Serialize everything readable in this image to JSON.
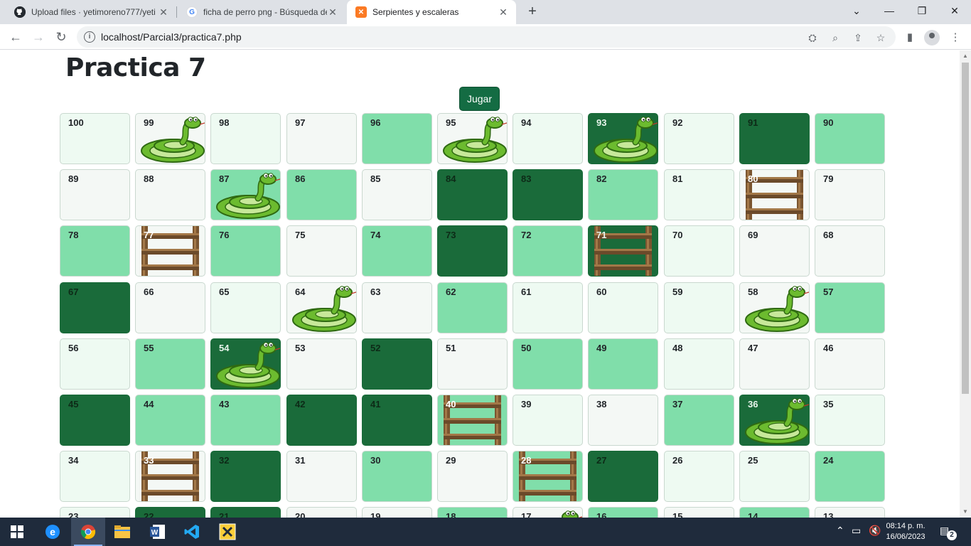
{
  "browser": {
    "tabs": [
      {
        "title": "Upload files · yetimoreno777/yeti",
        "icon": "github-icon",
        "active": false
      },
      {
        "title": "ficha de perro png - Búsqueda de",
        "icon": "google-icon",
        "active": false
      },
      {
        "title": "Serpientes y escaleras",
        "icon": "xampp-icon",
        "active": true
      }
    ],
    "new_tab_label": "+",
    "url": "localhost/Parcial3/practica7.php"
  },
  "page": {
    "title": "Practica 7",
    "play_button": "Jugar"
  },
  "board": {
    "colors": {
      "light": "#eefaf2",
      "white": "#f4f8f5",
      "mid": "#80deaa",
      "dark": "#1a6b3a"
    },
    "rows": [
      [
        {
          "n": "100",
          "color": "light"
        },
        {
          "n": "99",
          "color": "white",
          "piece": "snake"
        },
        {
          "n": "98",
          "color": "light"
        },
        {
          "n": "97",
          "color": "white"
        },
        {
          "n": "96",
          "color": "mid"
        },
        {
          "n": "95",
          "color": "white",
          "piece": "snake"
        },
        {
          "n": "94",
          "color": "light"
        },
        {
          "n": "93",
          "color": "dark",
          "piece": "snake"
        },
        {
          "n": "92",
          "color": "light"
        },
        {
          "n": "91",
          "color": "dark"
        },
        {
          "n": "90",
          "color": "mid"
        }
      ],
      [
        {
          "n": "89",
          "color": "white"
        },
        {
          "n": "88",
          "color": "white"
        },
        {
          "n": "87",
          "color": "mid",
          "piece": "snake"
        },
        {
          "n": "86",
          "color": "mid"
        },
        {
          "n": "85",
          "color": "white"
        },
        {
          "n": "84",
          "color": "dark"
        },
        {
          "n": "83",
          "color": "dark"
        },
        {
          "n": "82",
          "color": "mid"
        },
        {
          "n": "81",
          "color": "light"
        },
        {
          "n": "80",
          "color": "white",
          "piece": "ladder"
        },
        {
          "n": "79",
          "color": "white"
        }
      ],
      [
        {
          "n": "78",
          "color": "mid"
        },
        {
          "n": "77",
          "color": "white",
          "piece": "ladder"
        },
        {
          "n": "76",
          "color": "mid"
        },
        {
          "n": "75",
          "color": "white"
        },
        {
          "n": "74",
          "color": "mid"
        },
        {
          "n": "73",
          "color": "dark"
        },
        {
          "n": "72",
          "color": "mid"
        },
        {
          "n": "71",
          "color": "dark",
          "piece": "ladder"
        },
        {
          "n": "70",
          "color": "light"
        },
        {
          "n": "69",
          "color": "white"
        },
        {
          "n": "68",
          "color": "white"
        }
      ],
      [
        {
          "n": "67",
          "color": "dark"
        },
        {
          "n": "66",
          "color": "white"
        },
        {
          "n": "65",
          "color": "light"
        },
        {
          "n": "64",
          "color": "white",
          "piece": "snake"
        },
        {
          "n": "63",
          "color": "white"
        },
        {
          "n": "62",
          "color": "mid"
        },
        {
          "n": "61",
          "color": "light"
        },
        {
          "n": "60",
          "color": "light"
        },
        {
          "n": "59",
          "color": "light"
        },
        {
          "n": "58",
          "color": "white",
          "piece": "snake"
        },
        {
          "n": "57",
          "color": "mid"
        }
      ],
      [
        {
          "n": "56",
          "color": "light"
        },
        {
          "n": "55",
          "color": "mid"
        },
        {
          "n": "54",
          "color": "dark",
          "piece": "snake"
        },
        {
          "n": "53",
          "color": "white"
        },
        {
          "n": "52",
          "color": "dark"
        },
        {
          "n": "51",
          "color": "white"
        },
        {
          "n": "50",
          "color": "mid"
        },
        {
          "n": "49",
          "color": "mid"
        },
        {
          "n": "48",
          "color": "light"
        },
        {
          "n": "47",
          "color": "white"
        },
        {
          "n": "46",
          "color": "white"
        }
      ],
      [
        {
          "n": "45",
          "color": "dark"
        },
        {
          "n": "44",
          "color": "mid"
        },
        {
          "n": "43",
          "color": "mid"
        },
        {
          "n": "42",
          "color": "dark"
        },
        {
          "n": "41",
          "color": "dark"
        },
        {
          "n": "40",
          "color": "mid",
          "piece": "ladder"
        },
        {
          "n": "39",
          "color": "light"
        },
        {
          "n": "38",
          "color": "white"
        },
        {
          "n": "37",
          "color": "mid"
        },
        {
          "n": "36",
          "color": "dark",
          "piece": "snake"
        },
        {
          "n": "35",
          "color": "light"
        }
      ],
      [
        {
          "n": "34",
          "color": "light"
        },
        {
          "n": "33",
          "color": "white",
          "piece": "ladder"
        },
        {
          "n": "32",
          "color": "dark"
        },
        {
          "n": "31",
          "color": "white"
        },
        {
          "n": "30",
          "color": "mid"
        },
        {
          "n": "29",
          "color": "white"
        },
        {
          "n": "28",
          "color": "mid",
          "piece": "ladder"
        },
        {
          "n": "27",
          "color": "dark"
        },
        {
          "n": "26",
          "color": "light"
        },
        {
          "n": "25",
          "color": "light"
        },
        {
          "n": "24",
          "color": "mid"
        }
      ],
      [
        {
          "n": "23",
          "color": "light"
        },
        {
          "n": "22",
          "color": "dark"
        },
        {
          "n": "21",
          "color": "dark"
        },
        {
          "n": "20",
          "color": "white"
        },
        {
          "n": "19",
          "color": "white"
        },
        {
          "n": "18",
          "color": "mid"
        },
        {
          "n": "17",
          "color": "white",
          "piece": "snake"
        },
        {
          "n": "16",
          "color": "mid"
        },
        {
          "n": "15",
          "color": "white"
        },
        {
          "n": "14",
          "color": "mid"
        },
        {
          "n": "13",
          "color": "white"
        }
      ]
    ]
  },
  "taskbar": {
    "apps": [
      "windows-start-icon",
      "edge-icon",
      "chrome-icon",
      "file-explorer-icon",
      "word-icon",
      "vscode-icon",
      "xampp-icon"
    ],
    "time": "08:14 p. m.",
    "date": "16/06/2023",
    "notification_count": "2"
  }
}
